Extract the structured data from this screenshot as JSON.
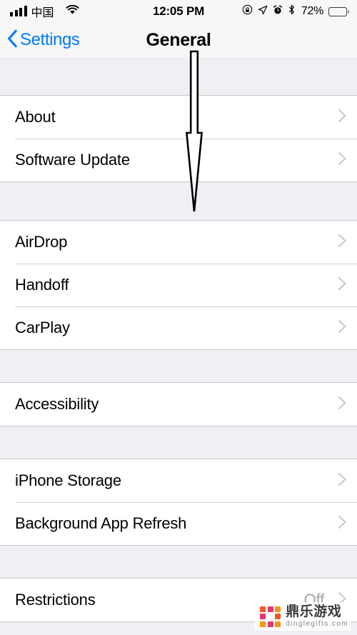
{
  "status_bar": {
    "carrier": "中国",
    "signal_icon": "signal-bars-icon",
    "wifi_icon": "wifi-icon",
    "time": "12:05 PM",
    "rotation_lock_icon": "rotation-lock-icon",
    "location_icon": "location-arrow-icon",
    "alarm_icon": "alarm-clock-icon",
    "bluetooth_icon": "bluetooth-icon",
    "battery_percent": "72%",
    "battery_level": 72,
    "battery_icon": "battery-icon"
  },
  "nav_bar": {
    "back_label": "Settings",
    "back_icon": "chevron-left-icon",
    "title": "General"
  },
  "colors": {
    "accent_blue": "#007aff",
    "group_background": "#efeff4",
    "row_background": "#ffffff",
    "separator": "#d3d3d8",
    "value_gray": "#a4a4a8",
    "label_black": "#000000"
  },
  "sections": [
    {
      "rows": [
        {
          "label": "About",
          "value": "",
          "accessory": "chevron-right-icon"
        },
        {
          "label": "Software Update",
          "value": "",
          "accessory": "chevron-right-icon"
        }
      ]
    },
    {
      "rows": [
        {
          "label": "AirDrop",
          "value": "",
          "accessory": "chevron-right-icon"
        },
        {
          "label": "Handoff",
          "value": "",
          "accessory": "chevron-right-icon"
        },
        {
          "label": "CarPlay",
          "value": "",
          "accessory": "chevron-right-icon"
        }
      ]
    },
    {
      "rows": [
        {
          "label": "Accessibility",
          "value": "",
          "accessory": "chevron-right-icon"
        }
      ]
    },
    {
      "rows": [
        {
          "label": "iPhone Storage",
          "value": "",
          "accessory": "chevron-right-icon"
        },
        {
          "label": "Background App Refresh",
          "value": "",
          "accessory": "chevron-right-icon"
        }
      ]
    },
    {
      "rows": [
        {
          "label": "Restrictions",
          "value": "Off",
          "accessory": "chevron-right-icon"
        }
      ]
    }
  ],
  "annotation": {
    "type": "down-arrow",
    "description": "hand-drawn downward pointing arrow outline overlay"
  },
  "watermark": {
    "name": "鼎乐游戏",
    "url": "dinglegifts.com",
    "logo_colors": [
      "#f05a28",
      "#e8366f",
      "#f7941e",
      "#e8366f",
      "#ffffff",
      "#f05a28",
      "#f7941e",
      "#e8366f",
      "#f7941e"
    ]
  }
}
